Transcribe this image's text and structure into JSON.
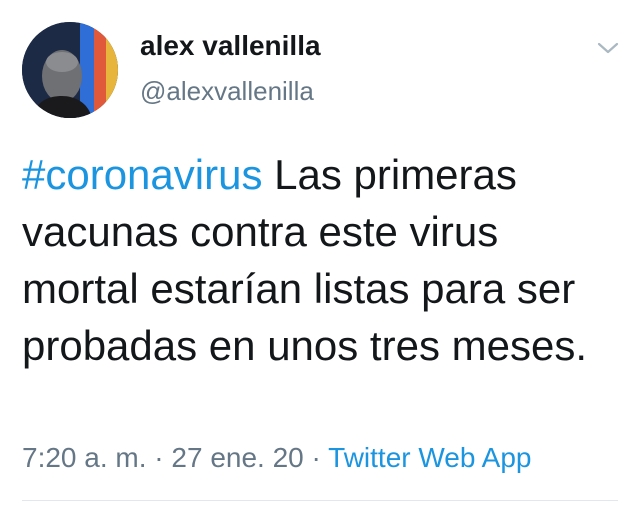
{
  "author": {
    "display_name": "alex vallenilla",
    "handle": "@alexvallenilla"
  },
  "tweet": {
    "hashtag": "#coronavirus",
    "text": " Las primeras vacunas contra este virus mortal estarían listas para ser probadas en unos tres meses."
  },
  "meta": {
    "time": "7:20 a. m.",
    "sep1": " · ",
    "date": "27 ene. 20",
    "sep2": " · ",
    "source": "Twitter Web App"
  },
  "icons": {
    "menu": "chevron-down-icon"
  },
  "colors": {
    "link": "#1b95e0",
    "secondary_text": "#657786",
    "primary_text": "#14171a"
  }
}
